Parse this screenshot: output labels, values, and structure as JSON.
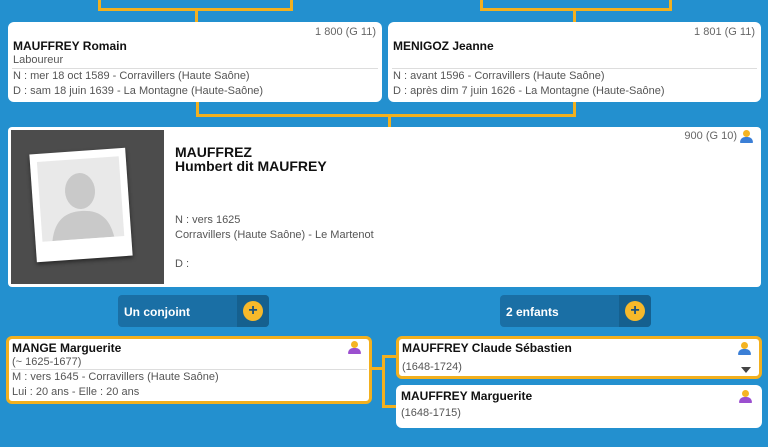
{
  "father": {
    "number": "1 800 (G 11)",
    "name": "MAUFFREY Romain",
    "occupation": "Laboureur",
    "birth": "N : mer 18 oct 1589 - Corravillers (Haute Saône)",
    "death": "D : sam 18 juin 1639 - La Montagne (Haute-Saône)"
  },
  "mother": {
    "number": "1 801 (G 11)",
    "name": "MENIGOZ Jeanne",
    "birth": "N : avant 1596 - Corravillers (Haute Saône)",
    "death": "D : après dim 7 juin 1626 - La Montagne (Haute-Saône)"
  },
  "main": {
    "number": "900 (G 10)",
    "last_name": "MAUFFREZ",
    "first_name": "Humbert dit MAUFREY",
    "birth_line": "N : vers 1625",
    "birth_place": "Corravillers (Haute Saône) - Le Martenot",
    "death": "D :",
    "icon": "male-person-icon"
  },
  "buttons": {
    "spouse_label": "Un conjoint",
    "children_label": "2 enfants",
    "plus": "+"
  },
  "spouse": {
    "name": "MANGE Marguerite",
    "dates": "(~ 1625-1677)",
    "marriage": "M : vers 1645 - Corravillers (Haute Saône)",
    "ages": "Lui : 20 ans - Elle : 20 ans",
    "icon": "female-person-icon"
  },
  "children": [
    {
      "name": "MAUFFREY Claude Sébastien",
      "dates": "(1648-1724)",
      "icon": "male-person-icon"
    },
    {
      "name": "MAUFFREY Marguerite",
      "dates": "(1648-1715)",
      "icon": "female-person-icon"
    }
  ],
  "colors": {
    "background": "#2390cf",
    "accent": "#f2b01e",
    "button": "#1a6fa5"
  }
}
